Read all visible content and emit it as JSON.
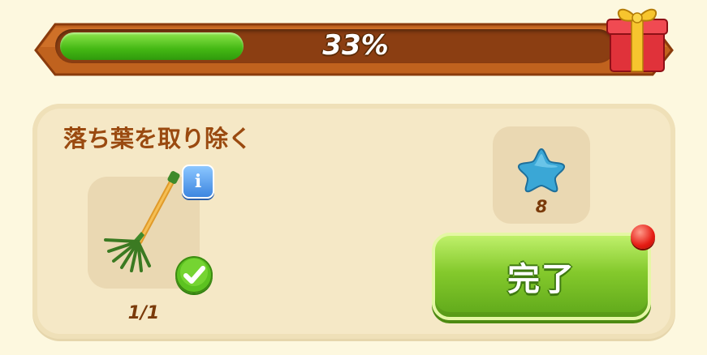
{
  "progress": {
    "percent_label": "33%",
    "fraction": 0.33
  },
  "task": {
    "title": "落ち葉を取り除く",
    "tool_icon": "rake-icon",
    "tool_progress": "1/1",
    "tool_completed": true
  },
  "reward": {
    "icon": "blue-star-icon",
    "amount": "8"
  },
  "complete_button": {
    "label": "完了",
    "has_notification": true
  },
  "colors": {
    "background": "#fdf8df",
    "banner_wood": "#b5581c",
    "progress_fill": "#44b814",
    "title_text": "#9a4a10",
    "button_green": "#84c92c",
    "notify_red": "#e51c14"
  }
}
